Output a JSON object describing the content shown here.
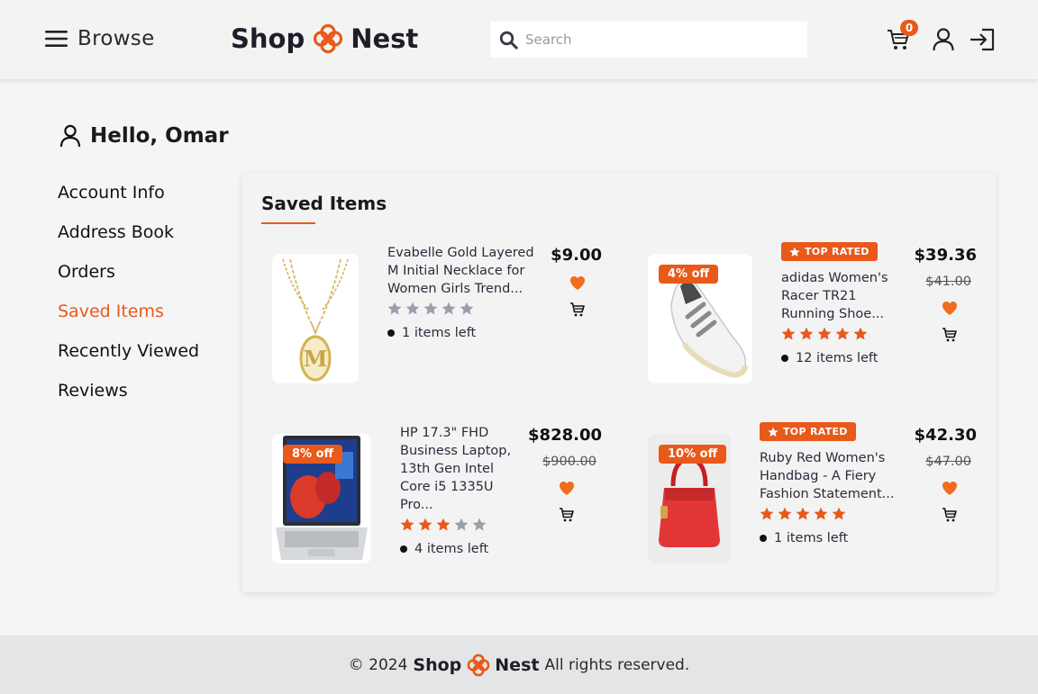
{
  "header": {
    "browse_label": "Browse",
    "logo_left": "Shop",
    "logo_right": "Nest",
    "search_placeholder": "Search",
    "cart_count": "0",
    "accent_color": "#e8591a"
  },
  "sidebar": {
    "greeting": "Hello, Omar",
    "items": [
      {
        "label": "Account Info"
      },
      {
        "label": "Address Book"
      },
      {
        "label": "Orders"
      },
      {
        "label": "Saved Items",
        "active": true
      },
      {
        "label": "Recently Viewed"
      },
      {
        "label": "Reviews"
      }
    ]
  },
  "saved": {
    "title": "Saved Items",
    "products": [
      {
        "name_lines": [
          "Evabelle Gold Layered",
          "M Initial Necklace for",
          "Women Girls Trend..."
        ],
        "price": "$9.00",
        "old_price": "",
        "discount": "",
        "top_rated": "",
        "rating": 0,
        "stock": "1 items left"
      },
      {
        "name_lines": [
          "adidas Women's",
          "Racer TR21",
          "Running Shoe..."
        ],
        "price": "$39.36",
        "old_price": "$41.00",
        "discount": "4% off",
        "top_rated": "TOP RATED",
        "rating": 5,
        "stock": "12 items left"
      },
      {
        "name_lines": [
          "HP 17.3\" FHD",
          "Business Laptop,",
          "13th Gen Intel",
          "Core i5 1335U",
          "Pro..."
        ],
        "price": "$828.00",
        "old_price": "$900.00",
        "discount": "8% off",
        "top_rated": "",
        "rating": 3,
        "stock": "4 items left"
      },
      {
        "name_lines": [
          "Ruby Red Women's",
          "Handbag - A Fiery",
          "Fashion Statement..."
        ],
        "price": "$42.30",
        "old_price": "$47.00",
        "discount": "10% off",
        "top_rated": "TOP RATED",
        "rating": 5,
        "stock": "1 items left"
      }
    ]
  },
  "footer": {
    "copyright": "© 2024",
    "brand_left": "Shop",
    "brand_right": "Nest",
    "rights": "All rights reserved."
  }
}
